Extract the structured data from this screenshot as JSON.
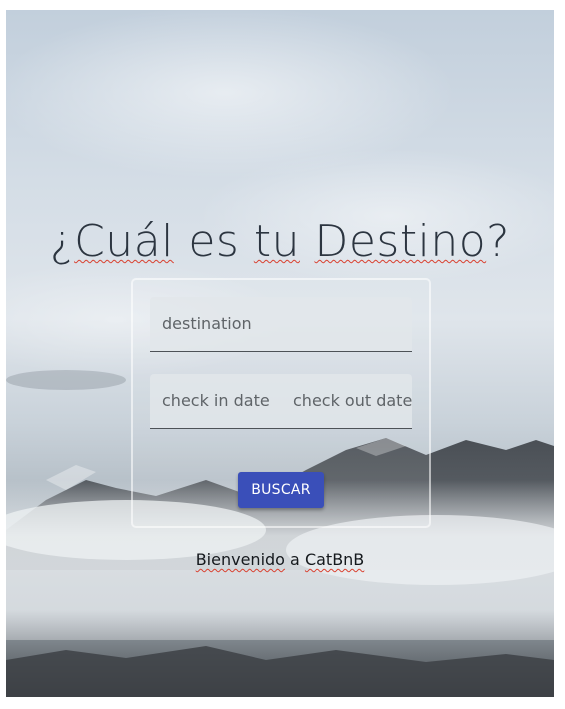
{
  "hero": {
    "title_prefix": "¿",
    "title_word1": "Cuál",
    "title_middle": " es ",
    "title_word2": "tu",
    "title_space": " ",
    "title_word3": "Destino",
    "title_suffix": "?"
  },
  "form": {
    "destination_placeholder": "destination",
    "check_in_placeholder": "check in date",
    "check_out_placeholder": "check out date",
    "search_button_label": "BUSCAR"
  },
  "footer": {
    "welcome_word1": "Bienvenido",
    "welcome_middle": " a ",
    "welcome_word2": "CatBnB"
  },
  "colors": {
    "button": "#3a4fb9",
    "title_text": "#2c3540",
    "spellcheck_underline": "#d9402f"
  }
}
